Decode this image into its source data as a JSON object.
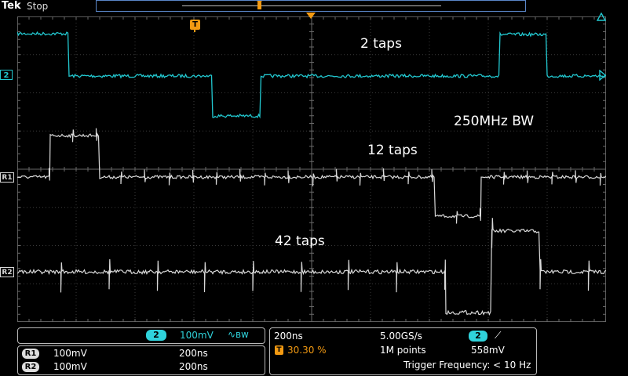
{
  "header": {
    "brand": "Tek",
    "status": "Stop"
  },
  "markers": {
    "trigger_t": "T",
    "ch2": "2",
    "r1": "R1",
    "r2": "R2"
  },
  "annotations": {
    "taps2": "2 taps",
    "bw": "250MHz BW",
    "taps12": "12 taps",
    "taps42": "42 taps"
  },
  "channel_readout": {
    "channel": "2",
    "scale": "100mV",
    "bw_symbol": "∿ʙw"
  },
  "ref_readout": [
    {
      "ref": "R1",
      "scale": "100mV",
      "time": "200ns"
    },
    {
      "ref": "R2",
      "scale": "100mV",
      "time": "200ns"
    }
  ],
  "timebase": {
    "time_per_div": "200ns",
    "sample_rate": "5.00GS/s",
    "trigger_source": "2",
    "trigger_slope": "⟋",
    "trigger_position_icon": "T",
    "trigger_position": "30.30 %",
    "record_length": "1M points",
    "trigger_level": "558mV",
    "trigger_frequency": "Trigger Frequency: < 10 Hz"
  },
  "colors": {
    "ch2": "#22c8d0",
    "ref": "#d8d8d8",
    "trigger": "#f39a12",
    "panel_border": "#b8b8b8",
    "badge_bg": "#2fd2db"
  },
  "icons": {
    "trigger_marker": "trigger-position-icon",
    "record_marker": "record-view-marker-icon"
  }
}
